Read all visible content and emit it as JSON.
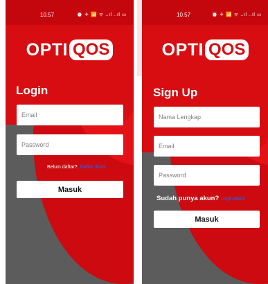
{
  "brand": {
    "logo_prefix": "OPTI",
    "logo_boxed": "QOS"
  },
  "colors": {
    "primary_red": "#d70d12",
    "background_grey": "#5c5c5c",
    "link_blue": "#2f63e8"
  },
  "login": {
    "status": {
      "time": "10.57",
      "icons": "⏰ ✈ 📶 ᯤ ..ıl ..ıl ▭"
    },
    "title": "Login",
    "email_placeholder": "Email",
    "password_placeholder": "Password",
    "register_prompt": "Belum daftar?.",
    "register_link": "Daftar disini",
    "submit_label": "Masuk"
  },
  "signup": {
    "status": {
      "time": "10.57",
      "icons": "⏰ ✈ 📶 ᯤ ..ıl ..ıl ▭"
    },
    "title": "Sign Up",
    "name_placeholder": "Nama Lengkap",
    "email_placeholder": "Email",
    "password_placeholder": "Password",
    "login_prompt": "Sudah punya akun?",
    "login_link": "Login disini",
    "submit_label": "Masuk"
  }
}
